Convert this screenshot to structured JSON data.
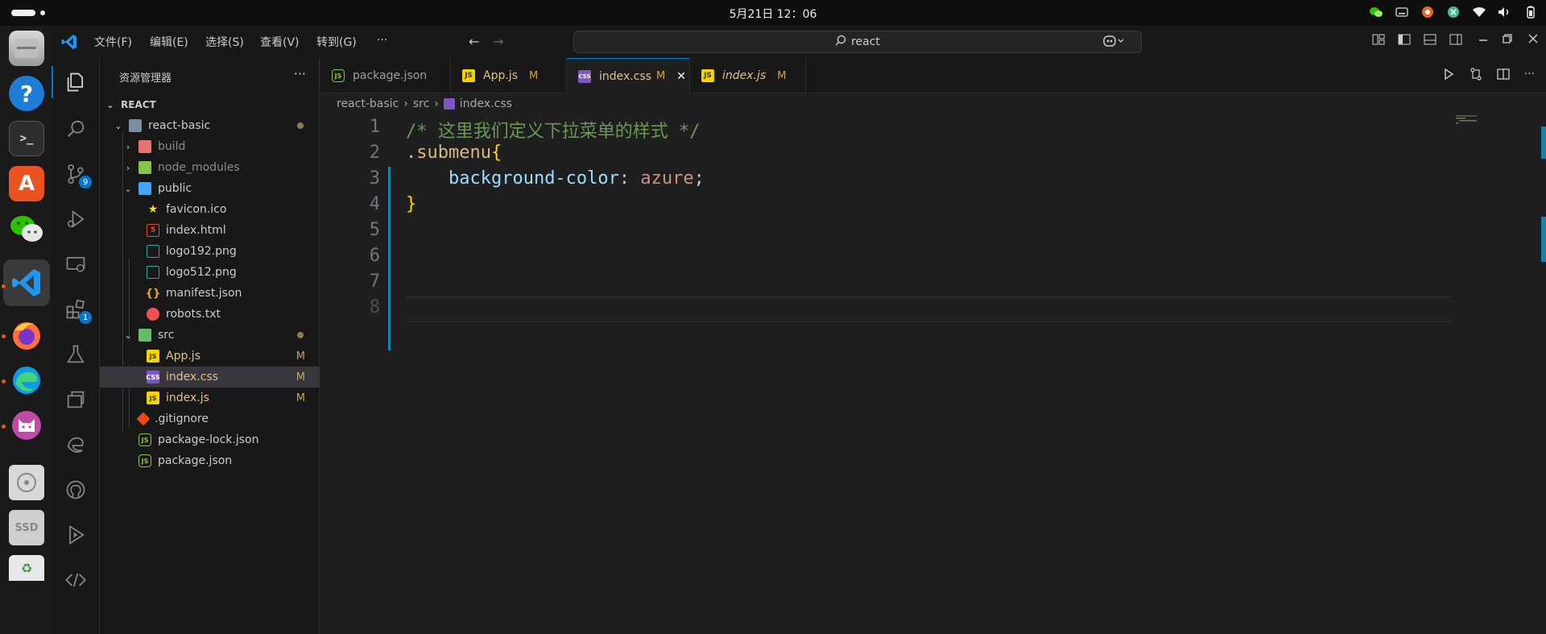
{
  "system": {
    "clock": "5月21日  12：06"
  },
  "titlebar": {
    "menus": [
      "文件(F)",
      "编辑(E)",
      "选择(S)",
      "查看(V)",
      "转到(G)",
      "···"
    ],
    "search_text": "react"
  },
  "activity": {
    "scm_badge": "9",
    "extensions_badge": "1"
  },
  "sidebar": {
    "title": "资源管理器",
    "more": "···",
    "root": "REACT",
    "items": [
      {
        "label": "react-basic"
      },
      {
        "label": "build"
      },
      {
        "label": "node_modules"
      },
      {
        "label": "public"
      },
      {
        "label": "favicon.ico"
      },
      {
        "label": "index.html"
      },
      {
        "label": "logo192.png"
      },
      {
        "label": "logo512.png"
      },
      {
        "label": "manifest.json"
      },
      {
        "label": "robots.txt"
      },
      {
        "label": "src"
      },
      {
        "label": "App.js",
        "mod": "M"
      },
      {
        "label": "index.css",
        "mod": "M"
      },
      {
        "label": "index.js",
        "mod": "M"
      },
      {
        "label": ".gitignore"
      },
      {
        "label": "package-lock.json"
      },
      {
        "label": "package.json"
      }
    ]
  },
  "tabs": [
    {
      "label": "package.json"
    },
    {
      "label": "App.js",
      "mod": "M"
    },
    {
      "label": "index.css",
      "mod": "M"
    },
    {
      "label": "index.js",
      "mod": "M"
    }
  ],
  "breadcrumb": [
    "react-basic",
    "src",
    "index.css"
  ],
  "editor": {
    "line_numbers": [
      "1",
      "2",
      "3",
      "4",
      "5",
      "6",
      "7",
      "8"
    ],
    "line1": "/* 这里我们定义下拉菜单的样式 */",
    "line2_selector": ".submenu",
    "line2_brace": "{",
    "line3_indent": "    ",
    "line3_prop": "background-color",
    "line3_colon": ": ",
    "line3_value": "azure",
    "line3_semi": ";",
    "line4_brace": "}"
  },
  "colors": {
    "accent": "#0078d4",
    "comment": "#6a9955",
    "selector": "#d7ba7d",
    "brace": "#ffd700",
    "property": "#9cdcfe",
    "value": "#ce9178",
    "modified": "#c8a45a"
  }
}
